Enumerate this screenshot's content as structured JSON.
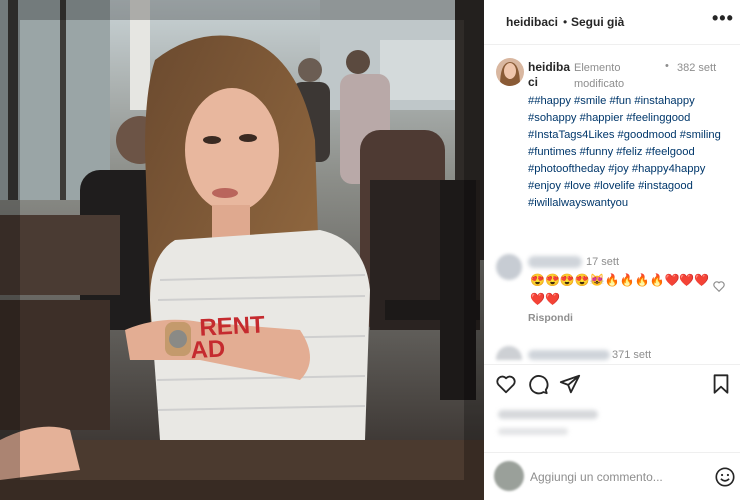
{
  "header": {
    "username": "heidibaci",
    "separator": "•",
    "follow_label": "Segui già",
    "more_label": "•••"
  },
  "caption": {
    "username": "heidibaci",
    "edited": "Elemento modificato",
    "dot": "•",
    "time": "382 sett",
    "hashtags": "##happy #smile #fun #instahappy #sohappy #happier #feelinggood #InstaTags4Likes #goodmood #smiling #funtimes #funny #feliz #feelgood #photooftheday #joy #happy4happy #enjoy #love #lovelife #instagood #iwillalwayswantyou"
  },
  "comments": [
    {
      "time": "17 sett",
      "text": "😍😍😍😍😻🔥🔥🔥🔥❤️❤️❤️❤️❤️",
      "reply_label": "Rispondi"
    },
    {
      "time": "371 sett"
    }
  ],
  "actions": {
    "like_icon": "heart-icon",
    "comment_icon": "comment-icon",
    "share_icon": "send-icon",
    "save_icon": "bookmark-icon"
  },
  "comment_box": {
    "placeholder": "Aggiungi un commento..."
  },
  "photo": {
    "shirt_text_line1": "RENT",
    "shirt_text_line2": "AD"
  }
}
